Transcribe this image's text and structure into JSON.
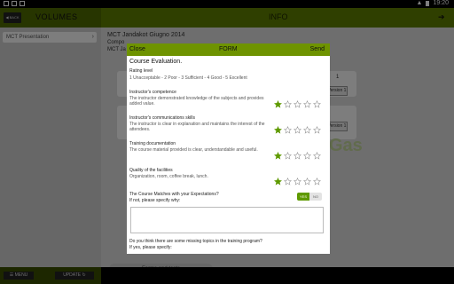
{
  "status_bar": {
    "time": "19:20"
  },
  "header": {
    "back_label": "BACK",
    "left_title": "VOLUMES",
    "right_title": "INFO"
  },
  "sidebar": {
    "items": [
      {
        "label": "MCT Presentation"
      }
    ]
  },
  "bottom_bar": {
    "menu_label": "MENU",
    "update_label": "UPDATE"
  },
  "background": {
    "title": "MCT Jandakot Giugno 2014",
    "line1": "Compo",
    "line2": "MCT Ja",
    "card1_text": "1",
    "version_badge": "Version 1",
    "version_badge2": "Version 1",
    "gas_text": "Gas",
    "forms_button": "Forms and tests"
  },
  "modal": {
    "close_label": "Close",
    "title": "FORM",
    "send_label": "Send",
    "section_title": "Course Evaluation.",
    "rating_level_label": "Rating level",
    "rating_scale": "1 Unacceptable - 2 Poor - 3 Sufficient - 4 Good - 5 Excellent",
    "questions": [
      {
        "label": "Instructor's competence",
        "desc": "The instructor demonstrated knowledge of the subjects and provides added value.",
        "rating": 1
      },
      {
        "label": "Instructor's communications skills",
        "desc": "The instructor is clear in explanation and maintains the interest of the attendees.",
        "rating": 1
      },
      {
        "label": "Training documentation",
        "desc": "The course material provided is clear, understandable and useful.",
        "rating": 1
      },
      {
        "label": "Quality of the facilities",
        "desc": "Organization, room, coffee break, lunch.",
        "rating": 1
      }
    ],
    "expectations_label": "The Course Matches with your Expectations?",
    "expectations_sub": "If not, please specify why:",
    "toggle_yes": "YES",
    "toggle_no": "NO",
    "missing_topics_label": "Do you think there are some missing topics in the training program?",
    "missing_topics_sub": "If yes, please specify:"
  },
  "colors": {
    "accent": "#6e9300",
    "star_filled": "#5f9a00",
    "star_empty": "#9a9a9a"
  }
}
